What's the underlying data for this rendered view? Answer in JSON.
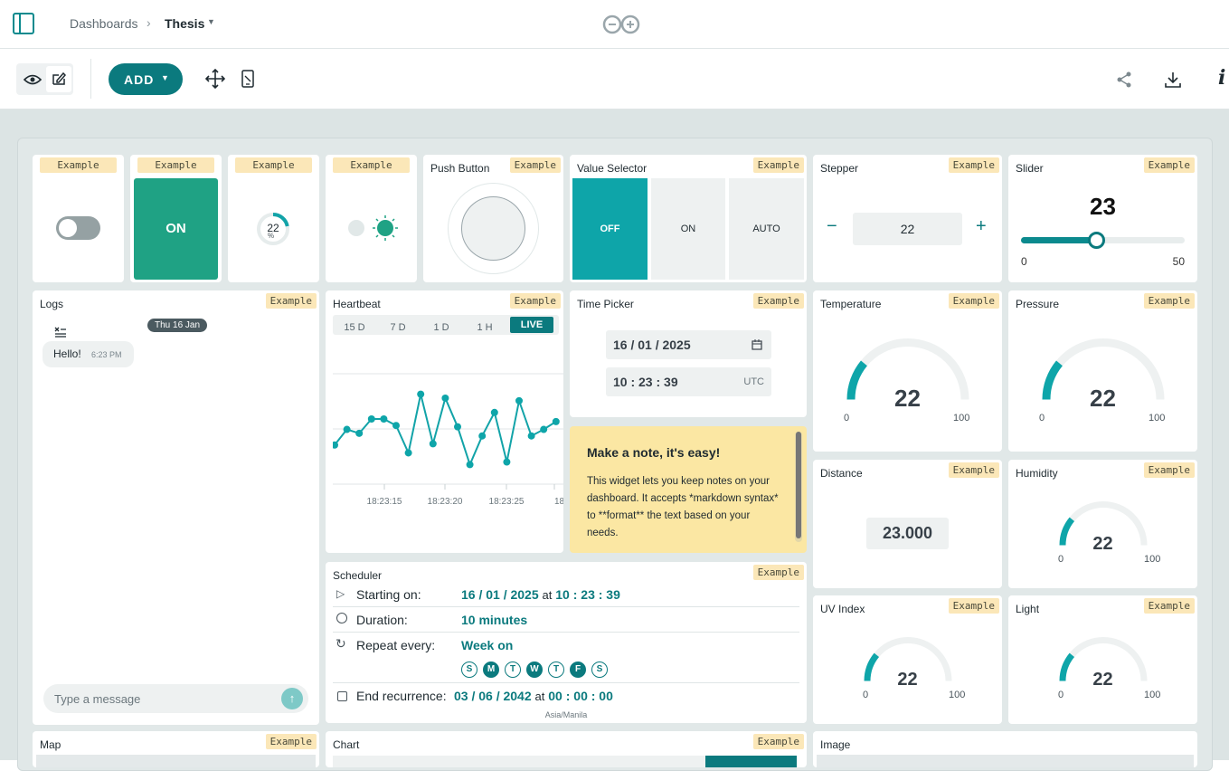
{
  "header": {
    "breadcrumb_root": "Dashboards",
    "dashboard_name": "Thesis"
  },
  "toolbar": {
    "add_label": "ADD"
  },
  "colors": {
    "teal": "#0b7a7e",
    "accent": "#12a3a8",
    "green": "#1fa284",
    "note": "#fbe7a3"
  },
  "widgets": {
    "example": "Example",
    "switch": {
      "state": "off"
    },
    "button_on": {
      "label": "ON"
    },
    "percentage": {
      "value": "22",
      "unit": "%",
      "fraction": 0.22
    },
    "push_button": {
      "title": "Push Button"
    },
    "value_selector": {
      "title": "Value Selector",
      "options": [
        "OFF",
        "ON",
        "AUTO"
      ],
      "selected": "OFF"
    },
    "stepper": {
      "title": "Stepper",
      "value": "22",
      "minus": "−",
      "plus": "+"
    },
    "slider": {
      "title": "Slider",
      "value": "23",
      "min": "0",
      "max": "50",
      "fraction": 0.46
    },
    "logs": {
      "title": "Logs",
      "date_chip": "Thu 16 Jan",
      "message": "Hello!",
      "time": "6:23 PM",
      "input_placeholder": "Type a message"
    },
    "heartbeat": {
      "title": "Heartbeat",
      "tabs": [
        "15 D",
        "7 D",
        "1 D",
        "1 H",
        "LIVE"
      ],
      "ticks": [
        "18:23:15",
        "18:23:20",
        "18:23:25",
        "18"
      ]
    },
    "time_picker": {
      "title": "Time Picker",
      "date": "16 / 01 / 2025",
      "time": "10 : 23 : 39",
      "tz": "UTC"
    },
    "note": {
      "title": "Make a note, it's easy!",
      "body": "This widget lets you keep notes on your dashboard. It accepts *markdown syntax* to **format** the text based on your needs."
    },
    "temperature": {
      "title": "Temperature",
      "value": "22",
      "min": "0",
      "max": "100",
      "fraction": 0.22
    },
    "pressure": {
      "title": "Pressure",
      "value": "22",
      "min": "0",
      "max": "100",
      "fraction": 0.22
    },
    "distance": {
      "title": "Distance",
      "value": "23.000"
    },
    "humidity": {
      "title": "Humidity",
      "value": "22",
      "min": "0",
      "max": "100",
      "fraction": 0.22
    },
    "uv_index": {
      "title": "UV Index",
      "value": "22",
      "min": "0",
      "max": "100",
      "fraction": 0.22
    },
    "light": {
      "title": "Light",
      "value": "22",
      "min": "0",
      "max": "100",
      "fraction": 0.22
    },
    "scheduler": {
      "title": "Scheduler",
      "starting_label": "Starting on:",
      "start_date": "16 / 01 / 2025",
      "at": "at",
      "start_time": "10 : 23 : 39",
      "duration_label": "Duration:",
      "duration": "10 minutes",
      "repeat_label": "Repeat every:",
      "repeat": "Week on",
      "days": [
        "S",
        "M",
        "T",
        "W",
        "T",
        "F",
        "S"
      ],
      "days_on": [
        false,
        true,
        false,
        true,
        false,
        true,
        false
      ],
      "end_label": "End recurrence:",
      "end_date": "03 / 06 / 2042",
      "end_time": "00 : 00 : 00",
      "tz": "Asia/Manila"
    },
    "map": {
      "title": "Map"
    },
    "chart": {
      "title": "Chart"
    },
    "image": {
      "title": "Image"
    }
  },
  "chart_data": {
    "type": "line",
    "title": "",
    "series": [
      {
        "values": [
          30,
          42,
          39,
          50,
          50,
          45,
          24,
          69,
          31,
          66,
          44,
          15,
          37,
          55,
          17,
          64,
          37,
          42,
          48
        ]
      }
    ],
    "ylim": [
      0,
      100
    ],
    "tick_labels": [
      "18:23:15",
      "18:23:20",
      "18:23:25",
      "18"
    ]
  }
}
